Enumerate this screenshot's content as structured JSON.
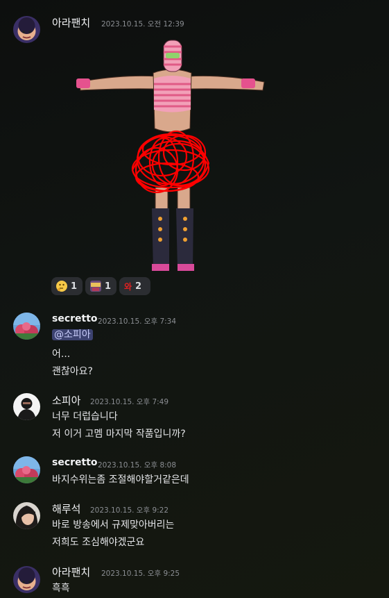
{
  "messages": [
    {
      "user": "아라팬치",
      "time": "2023.10.15. 오전 12:39",
      "lines": []
    },
    {
      "user": "secretto",
      "time": "2023.10.15. 오후 7:34",
      "mention": "@소피아",
      "lines": [
        "어...",
        "괜찮아요?"
      ]
    },
    {
      "user": "소피아",
      "time": "2023.10.15. 오후 7:49",
      "lines": [
        "너무 더럽습니다",
        "저 이거 고멤 마지막 작품입니까?"
      ]
    },
    {
      "user": "secretto",
      "time": "2023.10.15. 오후 8:08",
      "lines": [
        "바지수위는좀 조절해야할거같은데"
      ]
    },
    {
      "user": "해루석",
      "time": "2023.10.15. 오후 9:22",
      "lines": [
        "바로 방송에서 규제맞아버리는",
        "저희도 조심해야겠군요"
      ]
    },
    {
      "user": "아라팬치",
      "time": "2023.10.15. 오후 9:25",
      "lines": [
        "흑흑"
      ]
    }
  ],
  "reactions": [
    {
      "icon": "thinking-emoji-icon",
      "count": "1"
    },
    {
      "icon": "custom-sticker-emoji-icon",
      "count": "1"
    },
    {
      "icon": "oh-text-emoji-icon",
      "emoji_text": "와",
      "count": "2"
    }
  ],
  "colors": {
    "background": "#101311",
    "mention_bg": "#3c4270",
    "reaction_bg": "#2b2d31",
    "scribble": "#ff0000"
  }
}
